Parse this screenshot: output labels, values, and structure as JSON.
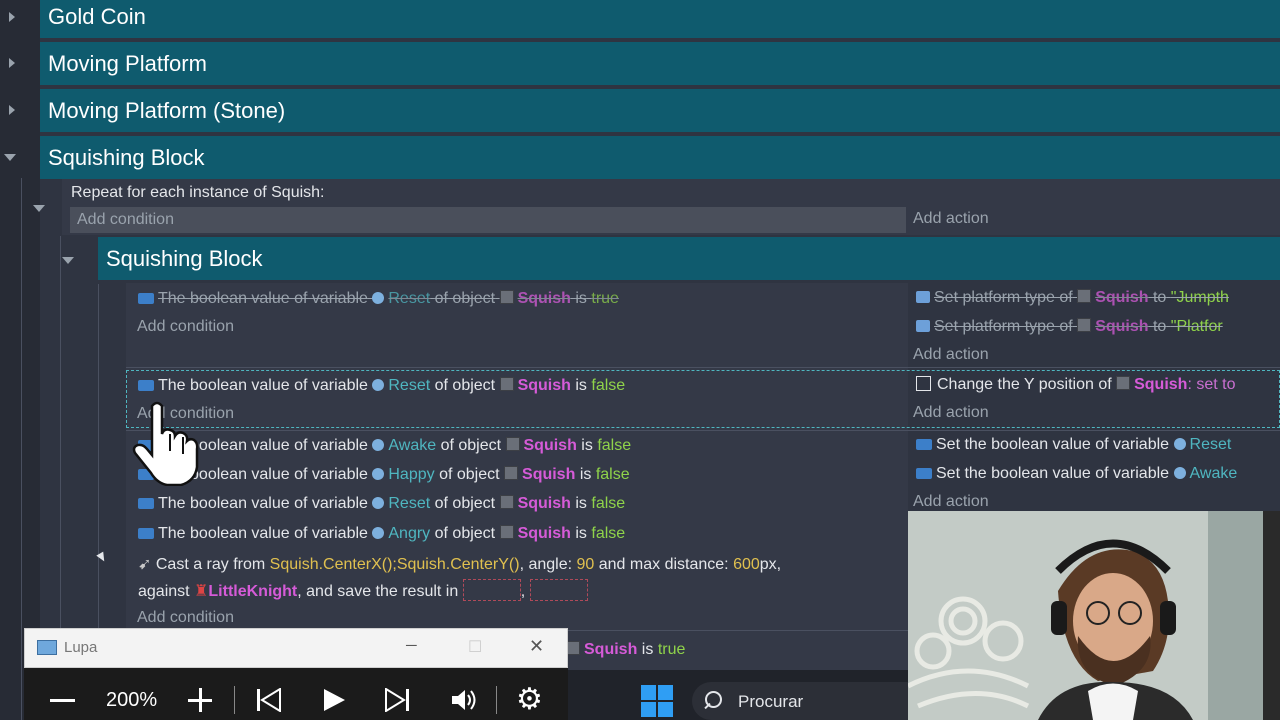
{
  "groups": {
    "g1": "Gold Coin",
    "g2": "Moving Platform",
    "g3": "Moving Platform (Stone)",
    "g4": "Squishing Block",
    "inner": "Squishing Block"
  },
  "foreach": {
    "label": "Repeat for each instance of Squish:",
    "add_condition": "Add condition",
    "add_action": "Add action"
  },
  "words": {
    "bool_var": "The boolean value of variable",
    "of_object": "of object",
    "is": "is",
    "true": "true",
    "false": "false",
    "squish": "Squish",
    "add_condition": "Add condition",
    "add_action": "Add action",
    "set_platform": "Set platform type of",
    "to": "to",
    "jump": "\"Jumpth",
    "platfor": "\"Platfor",
    "change_y": "Change the Y position of",
    "set_to": ": set to",
    "set_bool": "Set the boolean value of variable",
    "reset": "Reset",
    "awake": "Awake",
    "happy": "Happy",
    "angry": "Angry",
    "awake_cut": "Awake",
    "reset_cut": "Reset"
  },
  "raycast": {
    "line1_a": "Cast a ray from",
    "expr": "Squish.CenterX();Squish.CenterY()",
    "angle_label": ", angle:",
    "angle": "90",
    "dist_label": "and max distance:",
    "dist": "600",
    "px": "px,",
    "against": "against",
    "target": "LittleKnight",
    "save": ", and save the result in",
    "comma": ","
  },
  "magnifier": {
    "title": "Lupa",
    "zoom": "200%",
    "minimize": "─",
    "maximize": "☐",
    "close": "✕"
  },
  "taskbar": {
    "search": "Procurar"
  }
}
